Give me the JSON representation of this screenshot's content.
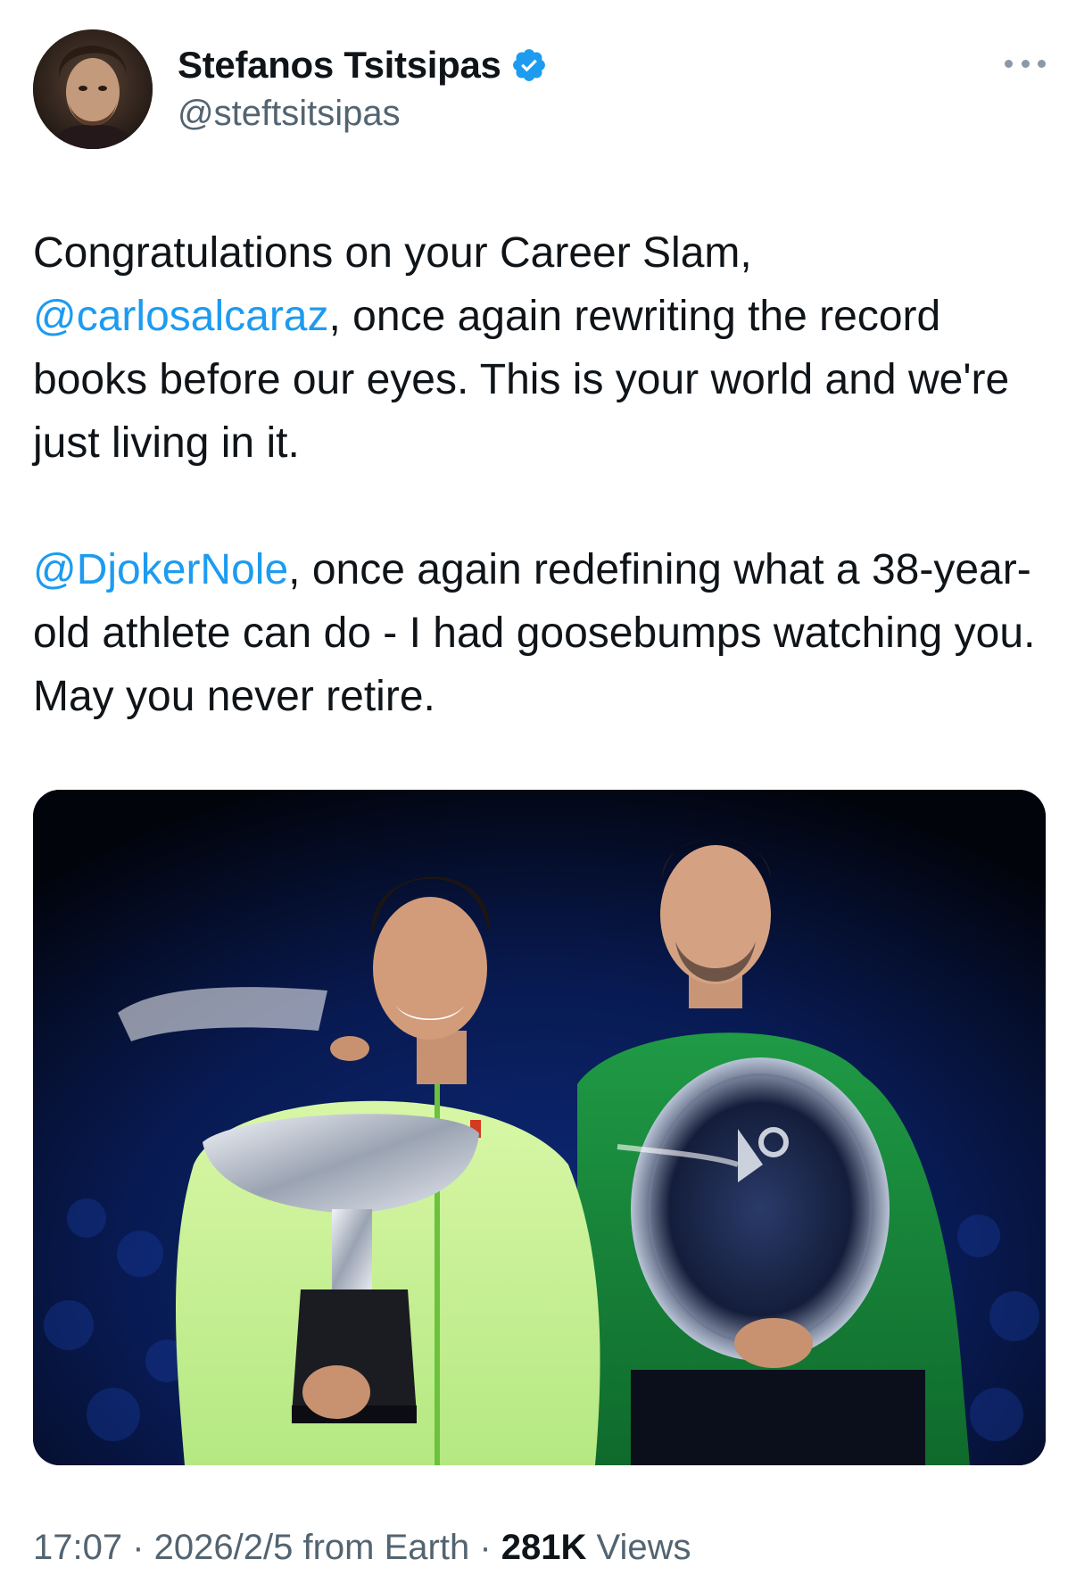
{
  "author": {
    "display_name": "Stefanos Tsitsipas",
    "handle": "@steftsitsipas",
    "verified": true,
    "verified_color": "#1d9bf0"
  },
  "tweet": {
    "para1": {
      "before": "Congratulations on your Career Slam, ",
      "mention": "@carlosalcaraz",
      "after": ", once again rewriting the record books before our eyes. This is your world and we're just living in it."
    },
    "para2": {
      "mention": "@DjokerNole",
      "after": ", once again redefining what a 38-year-old athlete can do - I had goosebumps watching you. May you never retire."
    }
  },
  "meta": {
    "time": "17:07",
    "sep1": " · ",
    "date": "2026/2/5",
    "location": " from Earth",
    "sep2": " · ",
    "views_count": "281K",
    "views_label": " Views"
  },
  "icons": {
    "more": "more-horizontal-icon",
    "verified": "verified-badge-icon"
  },
  "colors": {
    "link": "#1d9bf0",
    "secondary_text": "#536471",
    "primary_text": "#0f1419"
  }
}
